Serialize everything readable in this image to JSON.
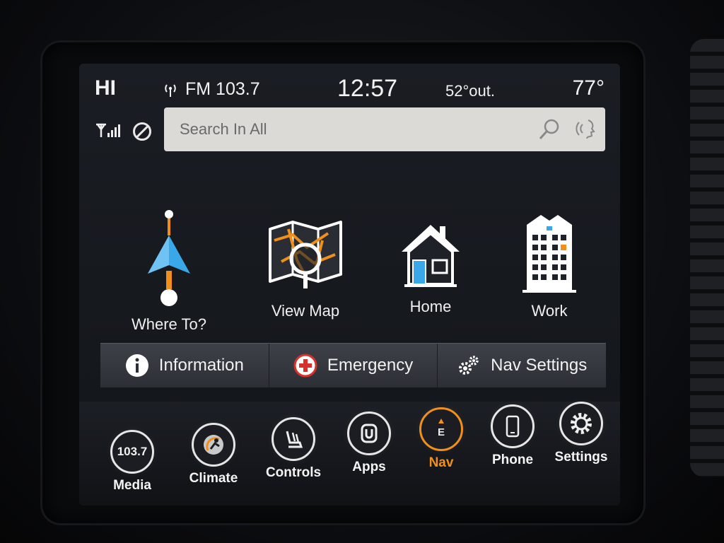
{
  "status": {
    "fan": "HI",
    "radio": "FM 103.7",
    "time": "12:57",
    "outside_temp": "52°out.",
    "cabin_temp": "77°"
  },
  "search": {
    "placeholder": "Search In All"
  },
  "nav_tiles": [
    {
      "label": "Where To?",
      "icon": "navigation-arrow-icon"
    },
    {
      "label": "View Map",
      "icon": "map-magnifier-icon"
    },
    {
      "label": "Home",
      "icon": "house-icon"
    },
    {
      "label": "Work",
      "icon": "office-building-icon"
    }
  ],
  "mid_buttons": [
    {
      "label": "Information",
      "icon": "info-icon"
    },
    {
      "label": "Emergency",
      "icon": "emergency-cross-icon"
    },
    {
      "label": "Nav Settings",
      "icon": "gears-icon"
    }
  ],
  "dock": {
    "media_icon_text": "103.7",
    "nav_icon_text": "E",
    "items": [
      {
        "label": "Media"
      },
      {
        "label": "Climate"
      },
      {
        "label": "Controls"
      },
      {
        "label": "Apps"
      },
      {
        "label": "Nav"
      },
      {
        "label": "Phone"
      },
      {
        "label": "Settings"
      }
    ],
    "active": "Nav"
  },
  "colors": {
    "accent": "#f0901a",
    "arrow": "#3aa7e8",
    "emergency": "#d8302a"
  }
}
